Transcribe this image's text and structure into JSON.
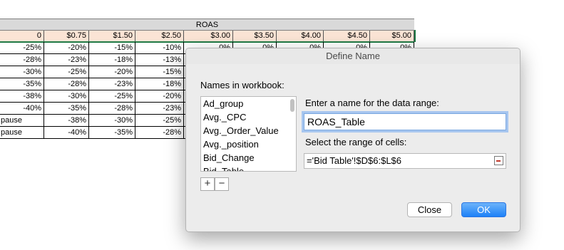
{
  "sheet": {
    "group_header": "ROAS",
    "columns": [
      "0",
      "$0.75",
      "$1.50",
      "$2.50",
      "$3.00",
      "$3.50",
      "$4.00",
      "$4.50",
      "$5.00"
    ],
    "rows": [
      {
        "label": "",
        "values": [
          "-25%",
          "-20%",
          "-15%",
          "-10%",
          "0%",
          "0%",
          "0%",
          "0%",
          "0%"
        ]
      },
      {
        "label": "",
        "values": [
          "-28%",
          "-23%",
          "-18%",
          "-13%",
          "",
          "",
          "",
          "",
          ""
        ]
      },
      {
        "label": "",
        "values": [
          "-30%",
          "-25%",
          "-20%",
          "-15%",
          "",
          "",
          "",
          "",
          ""
        ]
      },
      {
        "label": "",
        "values": [
          "-35%",
          "-28%",
          "-23%",
          "-18%",
          "",
          "",
          "",
          "",
          ""
        ]
      },
      {
        "label": "",
        "values": [
          "-38%",
          "-30%",
          "-25%",
          "-20%",
          "",
          "",
          "",
          "",
          ""
        ]
      },
      {
        "label": "",
        "values": [
          "-40%",
          "-35%",
          "-28%",
          "-23%",
          "",
          "",
          "",
          "",
          ""
        ]
      },
      {
        "label": "pause",
        "values": [
          "",
          "-38%",
          "-30%",
          "-25%",
          "",
          "",
          "",
          "",
          ""
        ]
      },
      {
        "label": "pause",
        "values": [
          "",
          "-40%",
          "-35%",
          "-28%",
          "",
          "",
          "",
          "",
          ""
        ]
      }
    ]
  },
  "dialog": {
    "title": "Define Name",
    "names_label": "Names in workbook:",
    "names": [
      "Ad_group",
      "Avg._CPC",
      "Avg._Order_Value",
      "Avg._position",
      "Bid_Change",
      "Bid_Table"
    ],
    "add_label": "+",
    "remove_label": "−",
    "name_prompt": "Enter a name for the data range:",
    "name_value": "ROAS_Table",
    "range_prompt": "Select the range of cells:",
    "range_value": "='Bid Table'!$D$6:$L$6",
    "close_label": "Close",
    "ok_label": "OK"
  },
  "colors": {
    "header_peach": "#fbe4d5",
    "header_gray": "#d9d9d9",
    "selection_green": "#1f7a45",
    "ok_blue": "#1e81f7"
  }
}
